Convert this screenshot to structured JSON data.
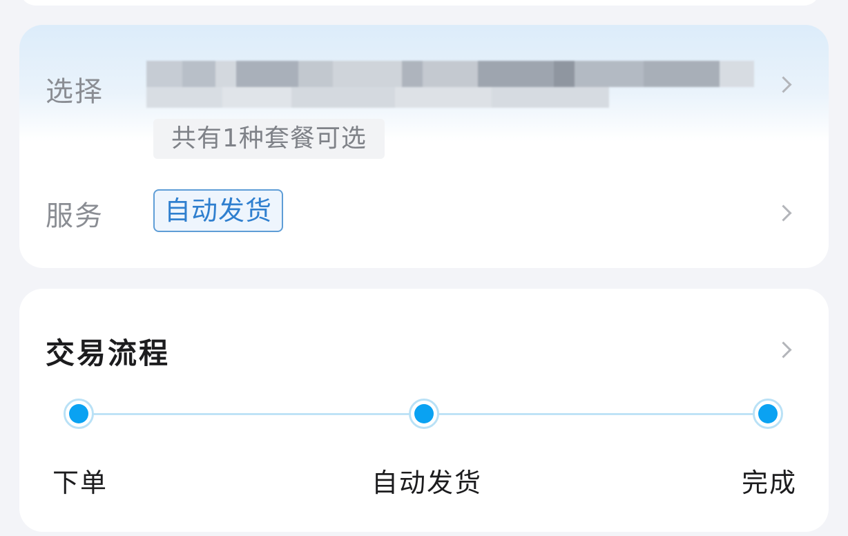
{
  "select_card": {
    "label": "选择",
    "package_hint": "共有1种套餐可选",
    "service_label": "服务",
    "service_tag": "自动发货"
  },
  "flow_card": {
    "title": "交易流程",
    "steps": [
      {
        "label": "下单"
      },
      {
        "label": "自动发货"
      },
      {
        "label": "完成"
      }
    ]
  },
  "colors": {
    "accent_blue": "#0aa2f2",
    "tag_blue": "#2f7fcf",
    "muted_text": "#8a8d93",
    "page_bg": "#f3f4f8"
  },
  "icons": {
    "row_arrow": "chevron-right-icon",
    "step_marker": "step-dot-icon"
  }
}
